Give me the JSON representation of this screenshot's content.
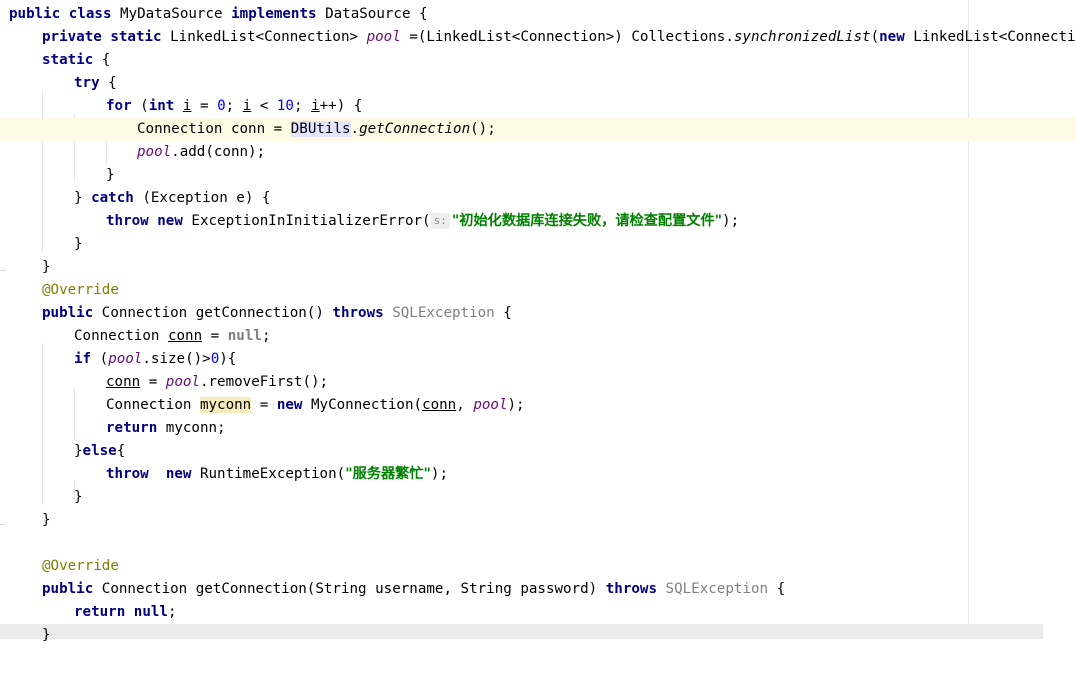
{
  "editor": {
    "colors": {
      "keyword": "#000080",
      "field": "#660e7a",
      "number": "#0000ff",
      "string": "#008000",
      "annotation": "#808000",
      "unused": "#808080",
      "caret_line": "#fffae3"
    },
    "lines": [
      {
        "id": "l1",
        "tokens": [
          "public",
          " ",
          "class",
          " MyDataSource ",
          "implements",
          " DataSource {"
        ]
      },
      {
        "id": "l2",
        "tokens": [
          "private",
          " ",
          "static",
          " LinkedList<Connection> ",
          "pool",
          " =(LinkedList<Connection>) Collections.",
          "synchronizedList",
          "(",
          "new",
          " LinkedList<Connection>())"
        ]
      },
      {
        "id": "l3",
        "tokens": [
          "static",
          " {"
        ]
      },
      {
        "id": "l4",
        "tokens": [
          "try",
          " {"
        ]
      },
      {
        "id": "l5",
        "tokens": [
          "for",
          " (",
          "int",
          " ",
          "i",
          " = ",
          "0",
          "; ",
          "i",
          " < ",
          "10",
          "; ",
          "i",
          "++) {"
        ]
      },
      {
        "id": "l6",
        "tokens": [
          "Connection conn = ",
          "DBUtils",
          ".",
          "getConnection",
          "();"
        ]
      },
      {
        "id": "l7",
        "tokens": [
          "pool",
          ".add(conn);"
        ]
      },
      {
        "id": "l8",
        "tokens": [
          "}"
        ]
      },
      {
        "id": "l9",
        "tokens": [
          "} ",
          "catch",
          " (Exception e) {"
        ]
      },
      {
        "id": "l10",
        "tokens": [
          "throw",
          " ",
          "new",
          " ExceptionInInitializerError(",
          "s:",
          "\"初始化数据库连接失败，请检查配置文件\"",
          ");"
        ]
      },
      {
        "id": "l11",
        "tokens": [
          "}"
        ]
      },
      {
        "id": "l12",
        "tokens": [
          "}"
        ]
      },
      {
        "id": "l13",
        "tokens": [
          "@Override"
        ]
      },
      {
        "id": "l14",
        "tokens": [
          "public",
          " Connection getConnection() ",
          "throws",
          " ",
          "SQLException",
          " {"
        ]
      },
      {
        "id": "l15",
        "tokens": [
          "Connection ",
          "conn",
          " = ",
          "null",
          ";"
        ]
      },
      {
        "id": "l16",
        "tokens": [
          "if",
          " (",
          "pool",
          ".size()>",
          "0",
          "){"
        ]
      },
      {
        "id": "l17",
        "tokens": [
          "conn",
          " = ",
          "pool",
          ".removeFirst();"
        ]
      },
      {
        "id": "l18",
        "tokens": [
          "Connection ",
          "myconn",
          " = ",
          "new",
          " MyConnection(",
          "conn",
          ", ",
          "pool",
          ");"
        ]
      },
      {
        "id": "l19",
        "tokens": [
          "return",
          " myconn;"
        ]
      },
      {
        "id": "l20",
        "tokens": [
          "}",
          "else",
          "{"
        ]
      },
      {
        "id": "l21",
        "tokens": [
          "throw",
          "  ",
          "new",
          " RuntimeException(",
          "\"服务器繁忙\"",
          ");"
        ]
      },
      {
        "id": "l22",
        "tokens": [
          "}"
        ]
      },
      {
        "id": "l23",
        "tokens": [
          "}"
        ]
      },
      {
        "id": "l24",
        "tokens": []
      },
      {
        "id": "l25",
        "tokens": [
          "@Override"
        ]
      },
      {
        "id": "l26",
        "tokens": [
          "public",
          " Connection getConnection(String username, String password) ",
          "throws",
          " ",
          "SQLException",
          " {"
        ]
      },
      {
        "id": "l27",
        "tokens": [
          "return",
          " ",
          "null",
          ";"
        ]
      },
      {
        "id": "l28",
        "tokens": [
          "}"
        ]
      }
    ]
  }
}
